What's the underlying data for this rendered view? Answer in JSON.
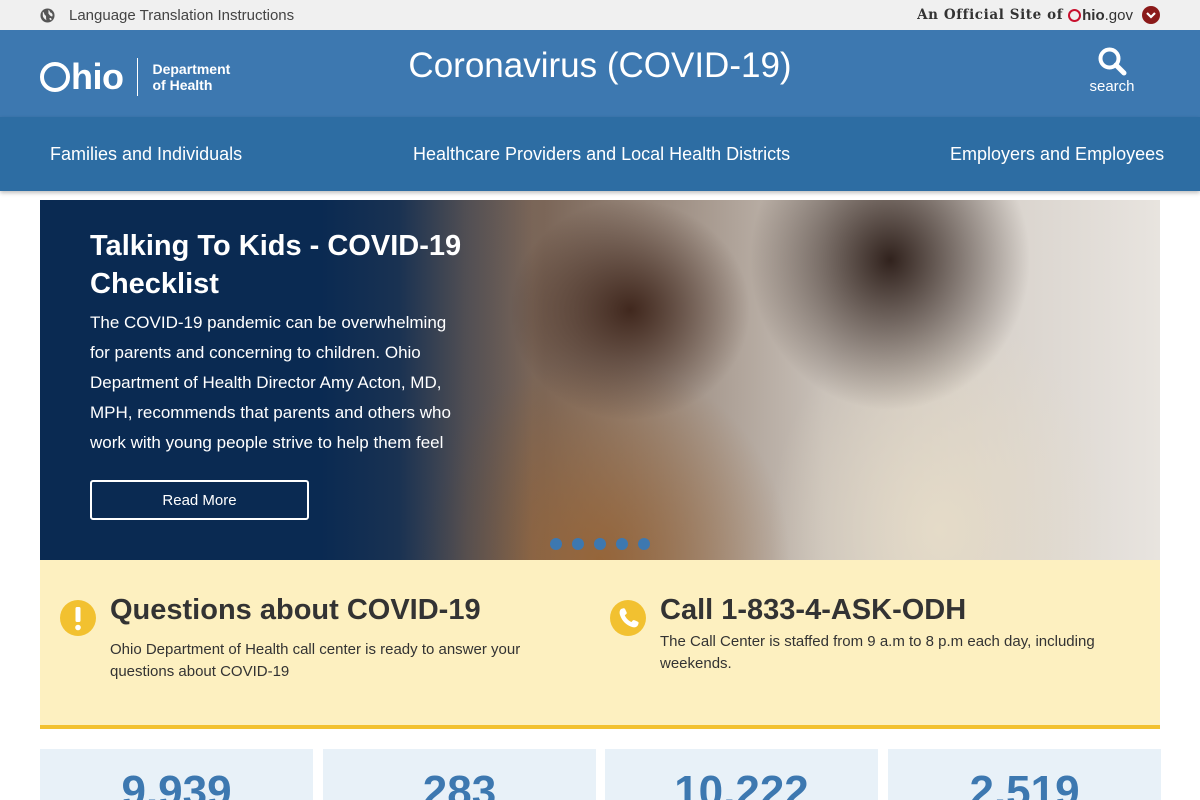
{
  "topbar": {
    "language_link": "Language Translation Instructions",
    "official_prefix": "An Official Site of",
    "ohio_gov_brand": "hio",
    "ohio_gov_suffix": ".gov"
  },
  "header": {
    "logo_text": "hio",
    "logo_dept_line1": "Department",
    "logo_dept_line2": "of Health",
    "title": "Coronavirus (COVID-19)",
    "search_label": "search"
  },
  "nav": {
    "items": [
      {
        "label": "Families and Individuals"
      },
      {
        "label": "Healthcare Providers and Local Health Districts"
      },
      {
        "label": "Employers and Employees"
      }
    ]
  },
  "hero": {
    "title": "Talking To Kids - COVID-19 Checklist",
    "text": "The COVID-19 pandemic can be overwhelming for parents and concerning to children. Ohio Department of Health Director Amy Acton, MD, MPH, recommends that parents and others who work with young people strive to help them feel",
    "button_label": "Read More",
    "slide_count": 5
  },
  "info": {
    "questions": {
      "heading": "Questions about COVID-19",
      "text": "Ohio Department of Health call center is ready to answer your questions about COVID-19"
    },
    "call": {
      "heading": "Call 1-833-4-ASK-ODH",
      "text": "The Call Center is staffed from 9 a.m to 8 p.m each day, including weekends."
    }
  },
  "stats": [
    {
      "value": "9,939"
    },
    {
      "value": "283"
    },
    {
      "value": "10,222"
    },
    {
      "value": "2,519"
    }
  ],
  "colors": {
    "header_blue": "#3d78b0",
    "nav_blue": "#2d6da3",
    "hero_navy": "#0a2a52",
    "info_yellow": "#fdf0c0",
    "accent_gold": "#f2c130",
    "ohio_red": "#c8102e"
  }
}
